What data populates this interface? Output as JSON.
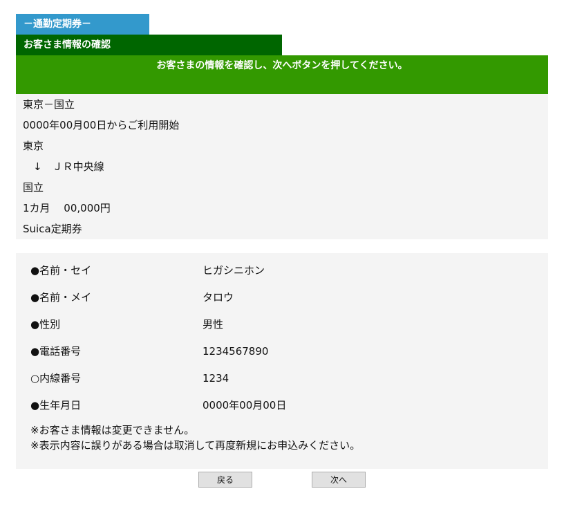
{
  "header": {
    "section_tag": "－通勤定期券－",
    "section_title": "お客さま情報の確認",
    "instruction": "お客さまの情報を確認し、次へボタンを押してください。"
  },
  "route": {
    "lines": [
      "東京－国立",
      "0000年00月00日からご利用開始",
      "東京",
      "　↓　ＪＲ中央線",
      "国立",
      "1カ月　 00,000円",
      "Suica定期券"
    ]
  },
  "customer": {
    "fields": [
      {
        "label": "●名前・セイ",
        "value": "ヒガシニホン"
      },
      {
        "label": "●名前・メイ",
        "value": "タロウ"
      },
      {
        "label": "●性別",
        "value": "男性"
      },
      {
        "label": "●電話番号",
        "value": "1234567890"
      },
      {
        "label": "○内線番号",
        "value": "1234"
      },
      {
        "label": "●生年月日",
        "value": "0000年00月00日"
      }
    ],
    "notes": [
      "※お客さま情報は変更できません。",
      "※表示内容に誤りがある場合は取消して再度新規にお申込みください。"
    ]
  },
  "buttons": {
    "back_label": "戻る",
    "next_label": "次へ"
  }
}
